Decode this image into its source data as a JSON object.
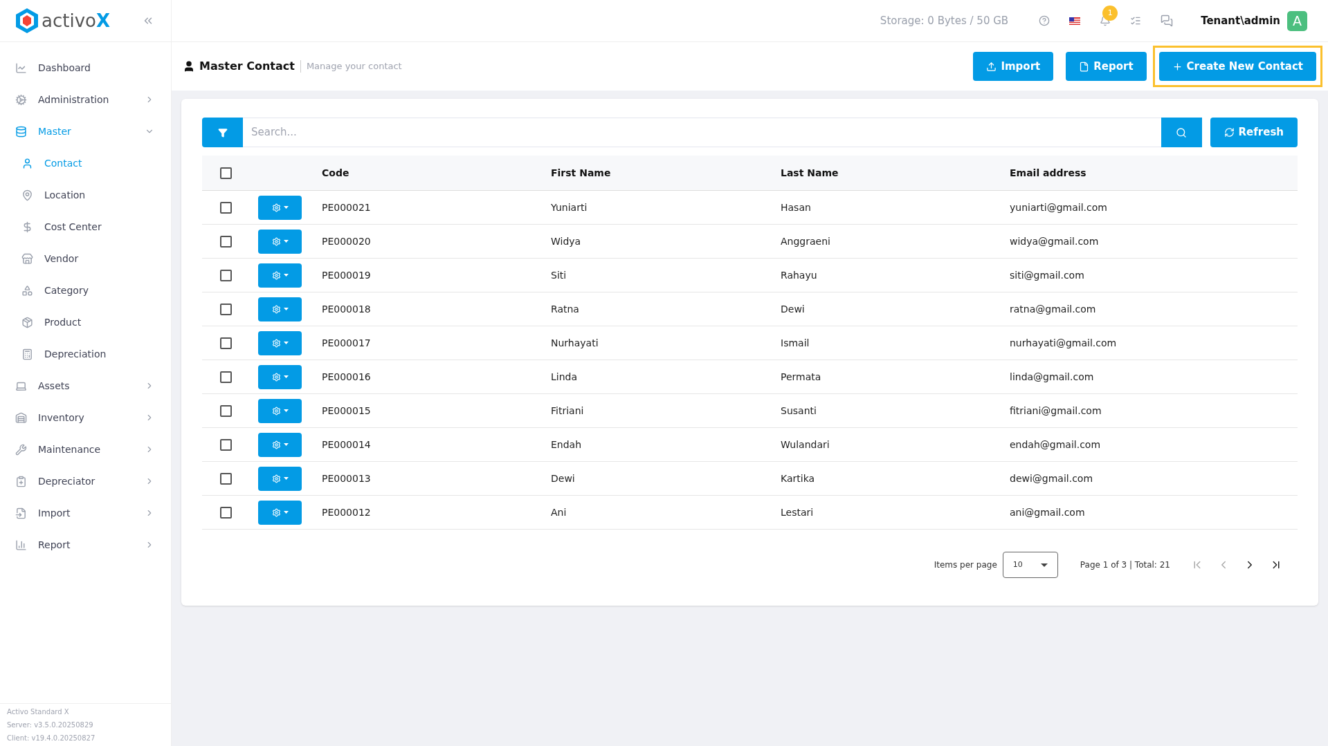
{
  "logo": {
    "text": "activo",
    "mark": "X"
  },
  "sidebar": {
    "items": [
      {
        "label": "Dashboard",
        "kind": "link",
        "selected": false
      },
      {
        "label": "Administration",
        "kind": "group",
        "selected": false,
        "expanded": false
      },
      {
        "label": "Master",
        "kind": "group",
        "selected": true,
        "expanded": true,
        "children": [
          {
            "label": "Contact",
            "selected": true
          },
          {
            "label": "Location",
            "selected": false
          },
          {
            "label": "Cost Center",
            "selected": false
          },
          {
            "label": "Vendor",
            "selected": false
          },
          {
            "label": "Category",
            "selected": false
          },
          {
            "label": "Product",
            "selected": false
          },
          {
            "label": "Depreciation",
            "selected": false
          }
        ]
      },
      {
        "label": "Assets",
        "kind": "group",
        "selected": false,
        "expanded": false
      },
      {
        "label": "Inventory",
        "kind": "group",
        "selected": false,
        "expanded": false
      },
      {
        "label": "Maintenance",
        "kind": "group",
        "selected": false,
        "expanded": false
      },
      {
        "label": "Depreciator",
        "kind": "group",
        "selected": false,
        "expanded": false
      },
      {
        "label": "Import",
        "kind": "group",
        "selected": false,
        "expanded": false
      },
      {
        "label": "Report",
        "kind": "group",
        "selected": false,
        "expanded": false
      }
    ],
    "footer": [
      "Activo Standard X",
      "Server: v3.5.0.20250829",
      "Client: v19.4.0.20250827"
    ]
  },
  "topbar": {
    "storage": "Storage: 0 Bytes / 50 GB",
    "notification_count": "1",
    "user": "Tenant\\admin",
    "avatar": "A"
  },
  "page": {
    "title": "Master Contact",
    "subtitle": "Manage your contact",
    "actions": [
      {
        "label": "Import",
        "highlighted": false
      },
      {
        "label": "Report",
        "highlighted": false
      },
      {
        "label": "Create New Contact",
        "highlighted": true
      }
    ]
  },
  "search": {
    "placeholder": "Search...",
    "refresh": "Refresh"
  },
  "table": {
    "select_all": false,
    "columns": [
      "Code",
      "First Name",
      "Last Name",
      "Email address"
    ],
    "rows": [
      {
        "checked": false,
        "cells": [
          "PE000021",
          "Yuniarti",
          "Hasan",
          "yuniarti@gmail.com"
        ]
      },
      {
        "checked": false,
        "cells": [
          "PE000020",
          "Widya",
          "Anggraeni",
          "widya@gmail.com"
        ]
      },
      {
        "checked": false,
        "cells": [
          "PE000019",
          "Siti",
          "Rahayu",
          "siti@gmail.com"
        ]
      },
      {
        "checked": false,
        "cells": [
          "PE000018",
          "Ratna",
          "Dewi",
          "ratna@gmail.com"
        ]
      },
      {
        "checked": false,
        "cells": [
          "PE000017",
          "Nurhayati",
          "Ismail",
          "nurhayati@gmail.com"
        ]
      },
      {
        "checked": false,
        "cells": [
          "PE000016",
          "Linda",
          "Permata",
          "linda@gmail.com"
        ]
      },
      {
        "checked": false,
        "cells": [
          "PE000015",
          "Fitriani",
          "Susanti",
          "fitriani@gmail.com"
        ]
      },
      {
        "checked": false,
        "cells": [
          "PE000014",
          "Endah",
          "Wulandari",
          "endah@gmail.com"
        ]
      },
      {
        "checked": false,
        "cells": [
          "PE000013",
          "Dewi",
          "Kartika",
          "dewi@gmail.com"
        ]
      },
      {
        "checked": false,
        "cells": [
          "PE000012",
          "Ani",
          "Lestari",
          "ani@gmail.com"
        ]
      }
    ]
  },
  "pagination": {
    "items_per_page_label": "Items per page",
    "items_per_page": "10",
    "summary": "Page 1 of 3 | Total: 21",
    "first_disabled": true,
    "prev_disabled": true,
    "next_disabled": false,
    "last_disabled": false
  }
}
